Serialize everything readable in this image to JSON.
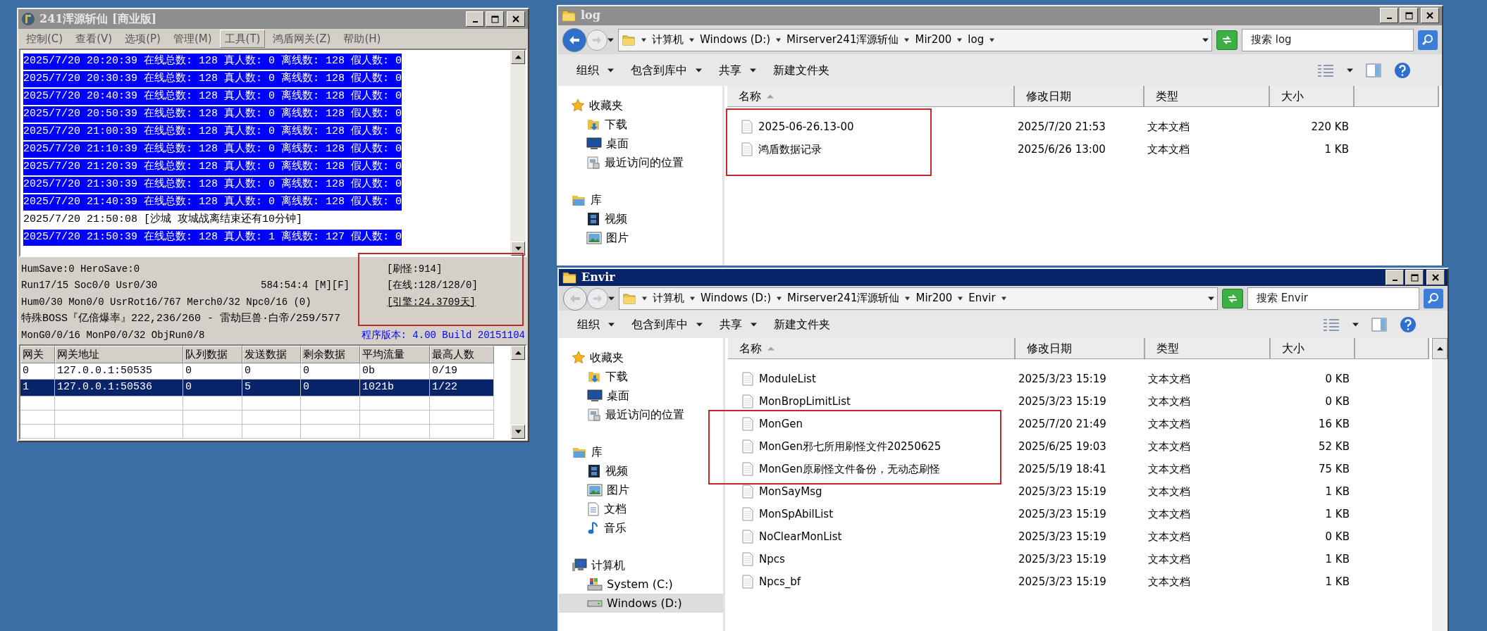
{
  "server_window": {
    "title": "241浑源斩仙 [商业版]",
    "active": false,
    "menu": [
      {
        "label": "控制(C)",
        "selected": false
      },
      {
        "label": "查看(V)",
        "selected": false
      },
      {
        "label": "选项(P)",
        "selected": false
      },
      {
        "label": "管理(M)",
        "selected": false
      },
      {
        "label": "工具(T)",
        "selected": true
      },
      {
        "label": "鸿盾网关(Z)",
        "selected": false
      },
      {
        "label": "帮助(H)",
        "selected": false
      }
    ],
    "log_lines": [
      {
        "text": "2025/7/20 20:20:39 在线总数: 128 真人数: 0 离线数: 128 假人数: 0",
        "selected": true
      },
      {
        "text": "2025/7/20 20:30:39 在线总数: 128 真人数: 0 离线数: 128 假人数: 0",
        "selected": true
      },
      {
        "text": "2025/7/20 20:40:39 在线总数: 128 真人数: 0 离线数: 128 假人数: 0",
        "selected": true
      },
      {
        "text": "2025/7/20 20:50:39 在线总数: 128 真人数: 0 离线数: 128 假人数: 0",
        "selected": true
      },
      {
        "text": "2025/7/20 21:00:39 在线总数: 128 真人数: 0 离线数: 128 假人数: 0",
        "selected": true
      },
      {
        "text": "2025/7/20 21:10:39 在线总数: 128 真人数: 0 离线数: 128 假人数: 0",
        "selected": true
      },
      {
        "text": "2025/7/20 21:20:39 在线总数: 128 真人数: 0 离线数: 128 假人数: 0",
        "selected": true
      },
      {
        "text": "2025/7/20 21:30:39 在线总数: 128 真人数: 0 离线数: 128 假人数: 0",
        "selected": true
      },
      {
        "text": "2025/7/20 21:40:39 在线总数: 128 真人数: 0 离线数: 128 假人数: 0",
        "selected": true
      },
      {
        "text": "2025/7/20 21:50:08 [沙城 攻城战离结束还有10分钟]",
        "selected": false
      },
      {
        "text": "2025/7/20 21:50:39 在线总数: 128 真人数: 1 离线数: 127 假人数: 0",
        "selected": true
      }
    ],
    "status": {
      "lines": [
        "HumSave:0 HeroSave:0",
        "Run17/15 Soc0/0 Usr0/30",
        "Hum0/30 Mon0/0 UsrRot16/767 Merch0/32 Npc0/16 (0)",
        "特殊BOSS『亿倍爆率』222,236/260 - 雷劫巨兽·白帝/259/577",
        "MonG0/0/16 MonP0/0/32 ObjRun0/8"
      ],
      "position": "584:54:4 [M][F]",
      "counters": [
        {
          "text": "[刷怪:914]",
          "underlined": false
        },
        {
          "text": "[在线:128/128/0]",
          "underlined": false
        },
        {
          "text": "[引擎:24.3709天]",
          "underlined": true
        }
      ],
      "version": "程序版本: 4.00 Build 20151104"
    },
    "table": {
      "columns": [
        "网关",
        "网关地址",
        "队列数据",
        "发送数据",
        "剩余数据",
        "平均流量",
        "最高人数"
      ],
      "rows": [
        {
          "cells": [
            "0",
            "127.0.0.1:50535",
            "0",
            "0",
            "0",
            "0b",
            "0/19"
          ],
          "selected": false
        },
        {
          "cells": [
            "1",
            "127.0.0.1:50536",
            "0",
            "5",
            "0",
            "1021b",
            "1/22"
          ],
          "selected": true
        }
      ]
    }
  },
  "log_window": {
    "title": "log",
    "active": false,
    "path": [
      "计算机",
      "Windows (D:)",
      "Mirserver241浑源斩仙",
      "Mir200",
      "log"
    ],
    "search": {
      "placeholder": "搜索 log"
    },
    "toolbar": [
      {
        "label": "组织",
        "menu": true
      },
      {
        "label": "包含到库中",
        "menu": true
      },
      {
        "label": "共享",
        "menu": true
      },
      {
        "label": "新建文件夹",
        "menu": false
      }
    ],
    "nav": [
      {
        "label": "收藏夹",
        "kind": "favorites",
        "selected": false,
        "children": [
          {
            "label": "下载",
            "kind": "downloads",
            "selected": false
          },
          {
            "label": "桌面",
            "kind": "desktop",
            "selected": false
          },
          {
            "label": "最近访问的位置",
            "kind": "recent",
            "selected": false
          }
        ]
      },
      {
        "label": "库",
        "kind": "libraries",
        "selected": false,
        "children": [
          {
            "label": "视频",
            "kind": "videos",
            "selected": false
          },
          {
            "label": "图片",
            "kind": "pictures",
            "selected": false
          }
        ]
      }
    ],
    "columns": [
      {
        "label": "名称",
        "sorted": true
      },
      {
        "label": "修改日期",
        "sorted": false
      },
      {
        "label": "类型",
        "sorted": false
      },
      {
        "label": "大小",
        "sorted": false
      }
    ],
    "files": [
      {
        "name": "2025-06-26.13-00",
        "modified": "2025/7/20 21:53",
        "type": "文本文档",
        "size": "220 KB"
      },
      {
        "name": "鸿盾数据记录",
        "modified": "2025/6/26 13:00",
        "type": "文本文档",
        "size": "1 KB"
      }
    ]
  },
  "envir_window": {
    "title": "Envir",
    "active": true,
    "path": [
      "计算机",
      "Windows (D:)",
      "Mirserver241浑源斩仙",
      "Mir200",
      "Envir"
    ],
    "search": {
      "placeholder": "搜索 Envir"
    },
    "toolbar": [
      {
        "label": "组织",
        "menu": true
      },
      {
        "label": "包含到库中",
        "menu": true
      },
      {
        "label": "共享",
        "menu": true
      },
      {
        "label": "新建文件夹",
        "menu": false
      }
    ],
    "nav": [
      {
        "label": "收藏夹",
        "kind": "favorites",
        "selected": false,
        "children": [
          {
            "label": "下载",
            "kind": "downloads",
            "selected": false
          },
          {
            "label": "桌面",
            "kind": "desktop",
            "selected": false
          },
          {
            "label": "最近访问的位置",
            "kind": "recent",
            "selected": false
          }
        ]
      },
      {
        "label": "库",
        "kind": "libraries",
        "selected": false,
        "children": [
          {
            "label": "视频",
            "kind": "videos",
            "selected": false
          },
          {
            "label": "图片",
            "kind": "pictures",
            "selected": false
          },
          {
            "label": "文档",
            "kind": "documents",
            "selected": false
          },
          {
            "label": "音乐",
            "kind": "music",
            "selected": false
          }
        ]
      },
      {
        "label": "计算机",
        "kind": "computer",
        "selected": false,
        "children": [
          {
            "label": "System (C:)",
            "kind": "system_drive",
            "selected": false
          },
          {
            "label": "Windows (D:)",
            "kind": "drive",
            "selected": true
          }
        ]
      }
    ],
    "columns": [
      {
        "label": "名称",
        "sorted": true
      },
      {
        "label": "修改日期",
        "sorted": false
      },
      {
        "label": "类型",
        "sorted": false
      },
      {
        "label": "大小",
        "sorted": false
      }
    ],
    "files": [
      {
        "name": "ModuleList",
        "modified": "2025/3/23 15:19",
        "type": "文本文档",
        "size": "0 KB"
      },
      {
        "name": "MonBropLimitList",
        "modified": "2025/3/23 15:19",
        "type": "文本文档",
        "size": "0 KB"
      },
      {
        "name": "MonGen",
        "modified": "2025/7/20 21:49",
        "type": "文本文档",
        "size": "16 KB"
      },
      {
        "name": "MonGen邪七所用刷怪文件20250625",
        "modified": "2025/6/25 19:03",
        "type": "文本文档",
        "size": "52 KB"
      },
      {
        "name": "MonGen原刷怪文件备份，无动态刷怪",
        "modified": "2025/5/19 18:41",
        "type": "文本文档",
        "size": "75 KB"
      },
      {
        "name": "MonSayMsg",
        "modified": "2025/3/23 15:19",
        "type": "文本文档",
        "size": "1 KB"
      },
      {
        "name": "MonSpAbilList",
        "modified": "2025/3/23 15:19",
        "type": "文本文档",
        "size": "1 KB"
      },
      {
        "name": "NoClearMonList",
        "modified": "2025/3/23 15:19",
        "type": "文本文档",
        "size": "0 KB"
      },
      {
        "name": "Npcs",
        "modified": "2025/3/23 15:19",
        "type": "文本文档",
        "size": "1 KB"
      },
      {
        "name": "Npcs_bf",
        "modified": "2025/3/23 15:19",
        "type": "文本文档",
        "size": "1 KB"
      }
    ]
  }
}
